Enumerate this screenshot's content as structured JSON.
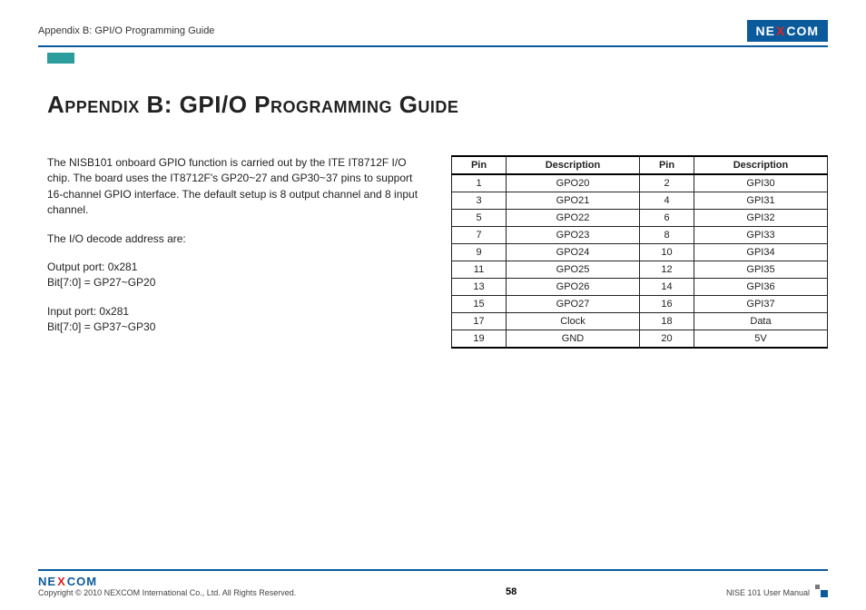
{
  "header": {
    "breadcrumb": "Appendix B: GPI/O Programming Guide",
    "logo_left": "NE",
    "logo_x": "X",
    "logo_right": "COM"
  },
  "title": "Appendix B: GPI/O Programming Guide",
  "body": {
    "para1": "The NISB101 onboard GPIO function is carried out by the ITE IT8712F I/O chip. The board uses the IT8712F's GP20~27 and GP30~37 pins to support 16-channel GPIO interface. The default setup is 8 output channel and 8 input channel.",
    "para2": "The I/O decode address are:",
    "para3a": "Output port: 0x281",
    "para3b": "Bit[7:0] = GP27~GP20",
    "para4a": "Input port: 0x281",
    "para4b": "Bit[7:0] = GP37~GP30"
  },
  "table": {
    "headers": [
      "Pin",
      "Description",
      "Pin",
      "Description"
    ],
    "rows": [
      [
        "1",
        "GPO20",
        "2",
        "GPI30"
      ],
      [
        "3",
        "GPO21",
        "4",
        "GPI31"
      ],
      [
        "5",
        "GPO22",
        "6",
        "GPI32"
      ],
      [
        "7",
        "GPO23",
        "8",
        "GPI33"
      ],
      [
        "9",
        "GPO24",
        "10",
        "GPI34"
      ],
      [
        "11",
        "GPO25",
        "12",
        "GPI35"
      ],
      [
        "13",
        "GPO26",
        "14",
        "GPI36"
      ],
      [
        "15",
        "GPO27",
        "16",
        "GPI37"
      ],
      [
        "17",
        "Clock",
        "18",
        "Data"
      ],
      [
        "19",
        "GND",
        "20",
        "5V"
      ]
    ]
  },
  "footer": {
    "copyright": "Copyright © 2010 NEXCOM International Co., Ltd. All Rights Reserved.",
    "page": "58",
    "manual": "NISE 101 User Manual",
    "logo_left": "NE",
    "logo_x": "X",
    "logo_right": "COM"
  }
}
